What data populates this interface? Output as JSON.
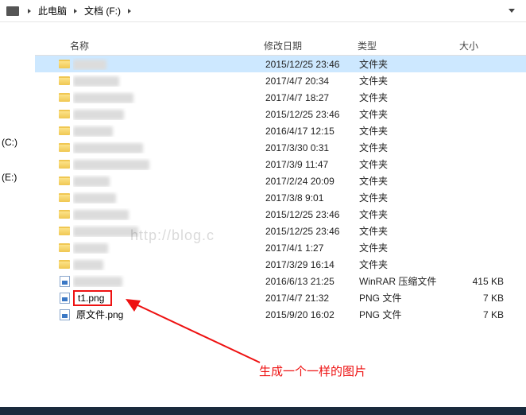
{
  "breadcrumb": {
    "segments": [
      "此电脑",
      "文档 (F:)"
    ]
  },
  "columns": {
    "name": "名称",
    "date": "修改日期",
    "type": "类型",
    "size": "大小"
  },
  "sidebar": {
    "items": [
      "(C:)",
      "(E:)"
    ]
  },
  "type_labels": {
    "folder": "文件夹",
    "winrar": "WinRAR 压缩文件",
    "png": "PNG 文件"
  },
  "files": [
    {
      "hidden_name": true,
      "name_len": 42,
      "date": "2015/12/25 23:46",
      "type": "folder",
      "selected": true
    },
    {
      "hidden_name": true,
      "name_len": 58,
      "date": "2017/4/7 20:34",
      "type": "folder"
    },
    {
      "hidden_name": true,
      "name_len": 76,
      "date": "2017/4/7 18:27",
      "type": "folder"
    },
    {
      "hidden_name": true,
      "name_len": 64,
      "date": "2015/12/25 23:46",
      "type": "folder"
    },
    {
      "hidden_name": true,
      "name_len": 50,
      "date": "2016/4/17 12:15",
      "type": "folder"
    },
    {
      "hidden_name": true,
      "name_len": 88,
      "date": "2017/3/30 0:31",
      "type": "folder"
    },
    {
      "hidden_name": true,
      "name_len": 96,
      "date": "2017/3/9 11:47",
      "type": "folder"
    },
    {
      "hidden_name": true,
      "name_len": 46,
      "date": "2017/2/24 20:09",
      "type": "folder"
    },
    {
      "hidden_name": true,
      "name_len": 54,
      "date": "2017/3/8 9:01",
      "type": "folder"
    },
    {
      "hidden_name": true,
      "name_len": 70,
      "date": "2015/12/25 23:46",
      "type": "folder"
    },
    {
      "hidden_name": true,
      "name_len": 82,
      "date": "2015/12/25 23:46",
      "type": "folder"
    },
    {
      "hidden_name": true,
      "name_len": 44,
      "date": "2017/4/1 1:27",
      "type": "folder"
    },
    {
      "hidden_name": true,
      "name_len": 38,
      "date": "2017/3/29 16:14",
      "type": "folder"
    },
    {
      "hidden_name": true,
      "name_len": 62,
      "date": "2016/6/13 21:25",
      "type": "winrar",
      "size": "415 KB"
    },
    {
      "name": "t1.png",
      "highlight": true,
      "date": "2017/4/7 21:32",
      "type": "png",
      "size": "7 KB"
    },
    {
      "name": "原文件.png",
      "date": "2015/9/20 16:02",
      "type": "png",
      "size": "7 KB"
    }
  ],
  "annotation": {
    "text": "生成一个一样的图片"
  },
  "watermark": "http://blog.c"
}
